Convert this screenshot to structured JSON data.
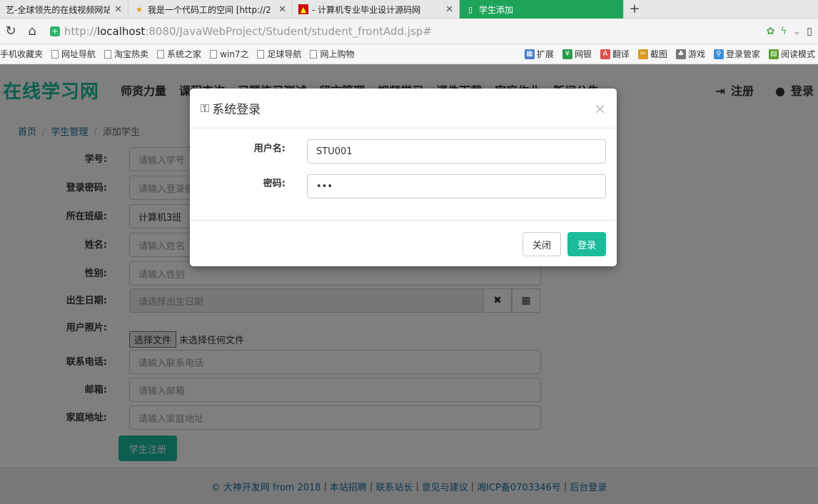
{
  "browser": {
    "tabs": [
      {
        "title": "艺-全球领先的在线视频网站",
        "active": false
      },
      {
        "title": "我是一个代码工的空间 [http://2",
        "active": false
      },
      {
        "title": "- 计算机专业毕业设计源码网",
        "active": false
      },
      {
        "title": "学生添加",
        "active": true
      }
    ],
    "url_prefix": "http://",
    "url_host": "localhost",
    "url_rest": ":8080/JavaWebProject/Student/student_frontAdd.jsp#",
    "bookmarks": [
      "手机收藏夹",
      "网址导航",
      "淘宝热卖",
      "系统之家",
      "win7之",
      "足球导航",
      "网上购物"
    ],
    "extensions": [
      "扩展",
      "网银",
      "翻译",
      "截图",
      "游戏",
      "登录管家",
      "阅读模式"
    ]
  },
  "site": {
    "logo": "在线学习网",
    "menu": [
      "师资力量",
      "课程查询",
      "习题练习测试",
      "留言管理",
      "视频学习",
      "课件下载",
      "家庭作业",
      "新闻公告"
    ],
    "register": "注册",
    "login": "登录"
  },
  "breadcrumb": {
    "home": "首页",
    "section": "学生管理",
    "current": "添加学生"
  },
  "form": {
    "student_no_label": "学号:",
    "student_no_placeholder": "请输入学号",
    "password_label": "登录密码:",
    "password_placeholder": "请输入登录密码",
    "class_label": "所在班级:",
    "class_value": "计算机3班",
    "name_label": "姓名:",
    "name_placeholder": "请输入姓名",
    "gender_label": "性别:",
    "gender_placeholder": "请输入性别",
    "birth_label": "出生日期:",
    "birth_placeholder": "请选择出生日期",
    "photo_label": "用户照片:",
    "file_button": "选择文件",
    "file_status": "未选择任何文件",
    "phone_label": "联系电话:",
    "phone_placeholder": "请输入联系电话",
    "email_label": "邮箱:",
    "email_placeholder": "请输入邮箱",
    "address_label": "家庭地址:",
    "address_placeholder": "请输入家庭地址",
    "submit": "学生注册"
  },
  "footer": {
    "items": [
      "© 大神开发网 from 2018",
      "本站招聘",
      "联系站长",
      "意见与建议",
      "湘ICP备0703346号",
      "后台登录"
    ]
  },
  "modal": {
    "title": "系统登录",
    "username_label": "用户名:",
    "username_value": "STU001",
    "password_label": "密码:",
    "password_value": "•••",
    "close_button": "关闭",
    "login_button": "登录"
  }
}
